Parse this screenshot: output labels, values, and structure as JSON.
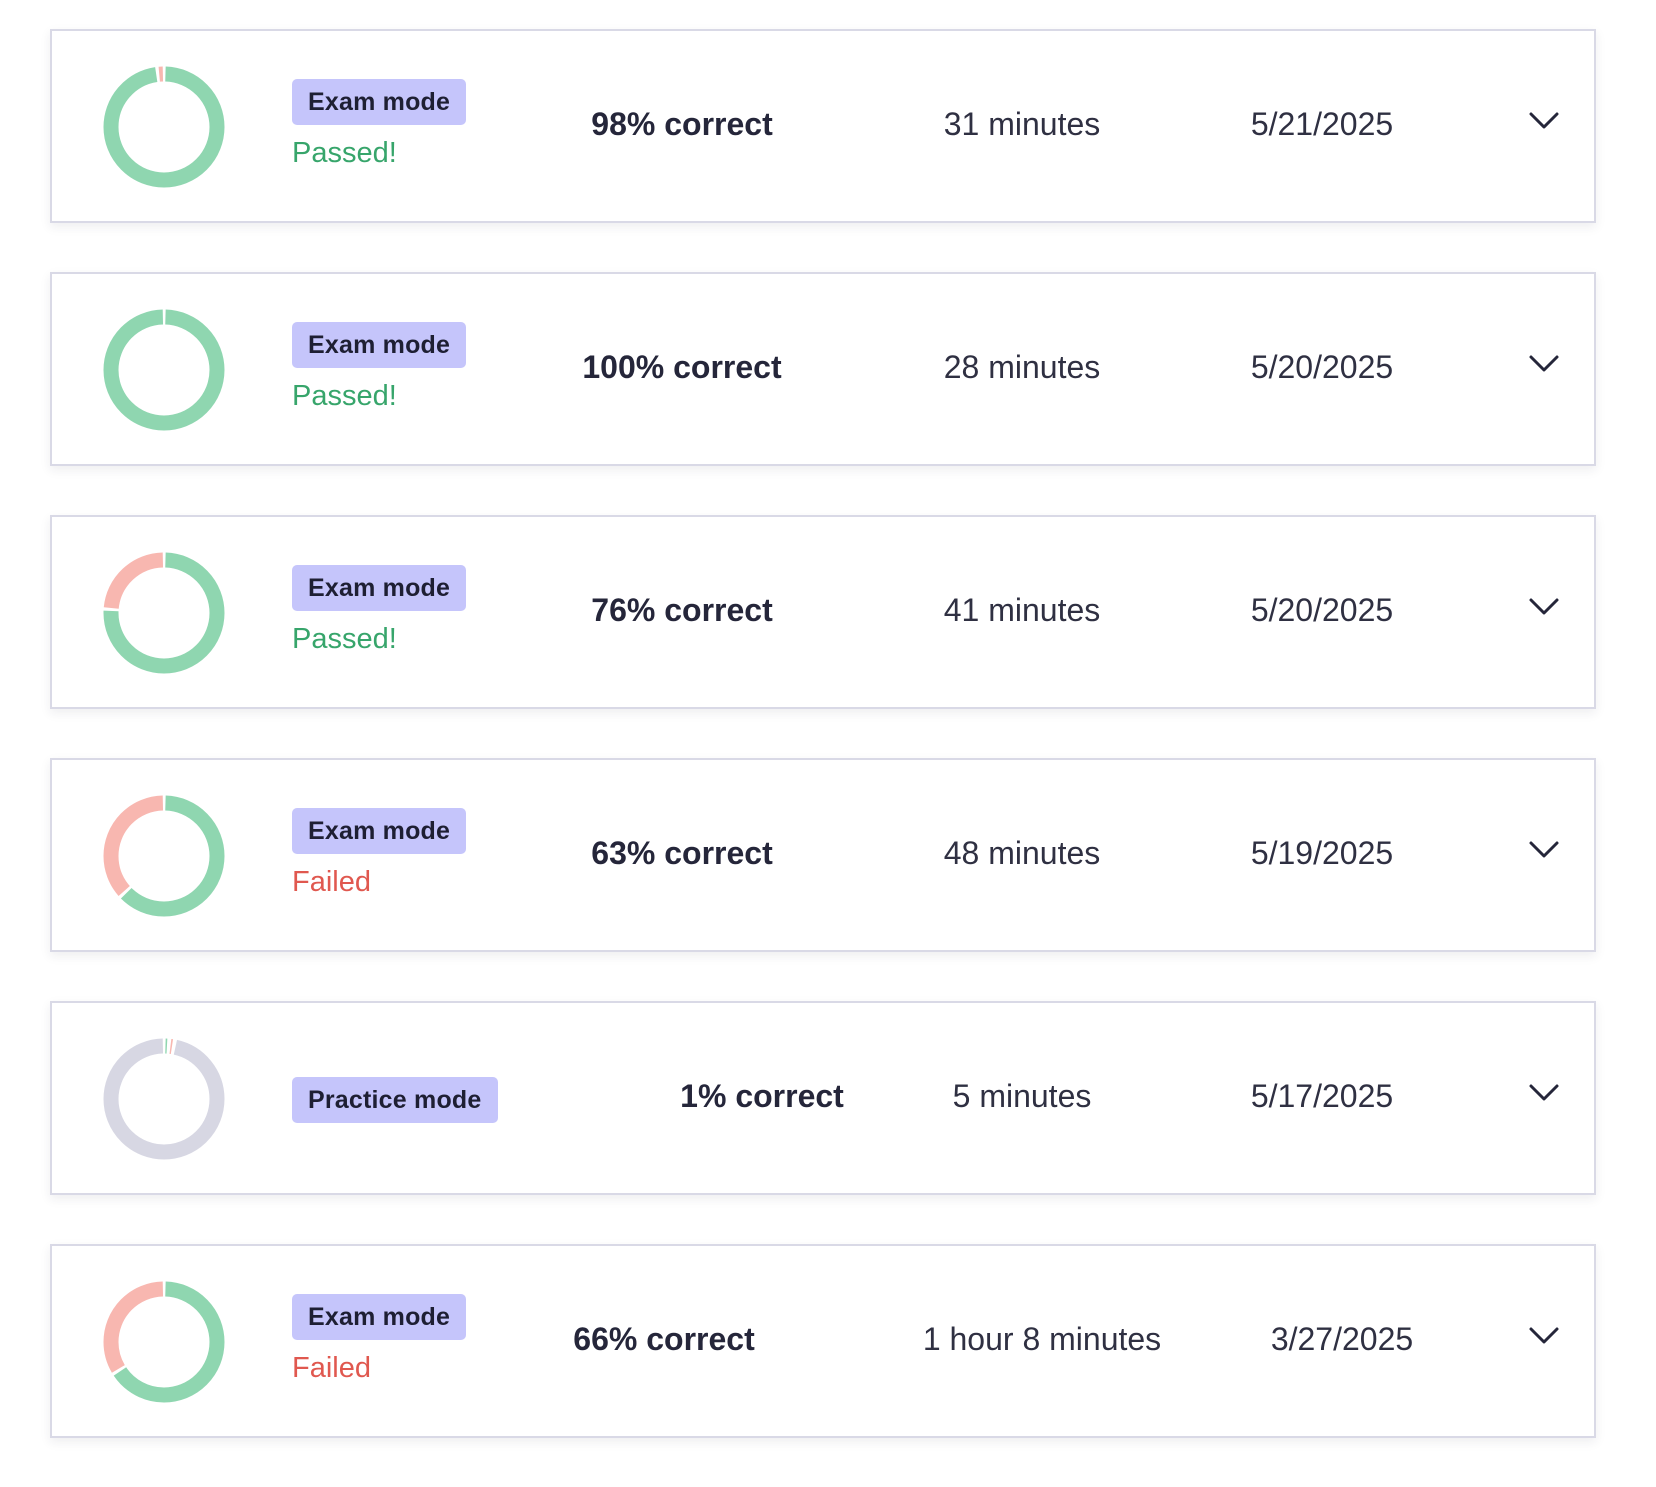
{
  "colors": {
    "correct": "#8fd6b0",
    "incorrect": "#f8b7b0",
    "neutral": "#d7d7e3",
    "badge_bg": "#c5c5fb",
    "passed_text": "#37a56b",
    "failed_text": "#e0584f"
  },
  "attempts": [
    {
      "mode": "Exam mode",
      "status": "Passed!",
      "status_kind": "passed",
      "score": "98% correct",
      "correct_fraction": 0.98,
      "duration": "31 minutes",
      "date": "5/21/2025",
      "chevron_icon": "chevron-down-icon"
    },
    {
      "mode": "Exam mode",
      "status": "Passed!",
      "status_kind": "passed",
      "score": "100% correct",
      "correct_fraction": 1.0,
      "duration": "28 minutes",
      "date": "5/20/2025",
      "chevron_icon": "chevron-down-icon"
    },
    {
      "mode": "Exam mode",
      "status": "Passed!",
      "status_kind": "passed",
      "score": "76% correct",
      "correct_fraction": 0.76,
      "duration": "41 minutes",
      "date": "5/20/2025",
      "chevron_icon": "chevron-down-icon"
    },
    {
      "mode": "Exam mode",
      "status": "Failed",
      "status_kind": "failed",
      "score": "63% correct",
      "correct_fraction": 0.63,
      "duration": "48 minutes",
      "date": "5/19/2025",
      "chevron_icon": "chevron-down-icon"
    },
    {
      "mode": "Practice mode",
      "status": "",
      "status_kind": "none",
      "score": "1% correct",
      "correct_fraction": 0.01,
      "duration": "5 minutes",
      "date": "5/17/2025",
      "chevron_icon": "chevron-down-icon"
    },
    {
      "mode": "Exam mode",
      "status": "Failed",
      "status_kind": "failed",
      "score": "66% correct",
      "correct_fraction": 0.66,
      "duration": "1 hour 8 minutes",
      "date": "3/27/2025",
      "chevron_icon": "chevron-down-icon"
    }
  ]
}
